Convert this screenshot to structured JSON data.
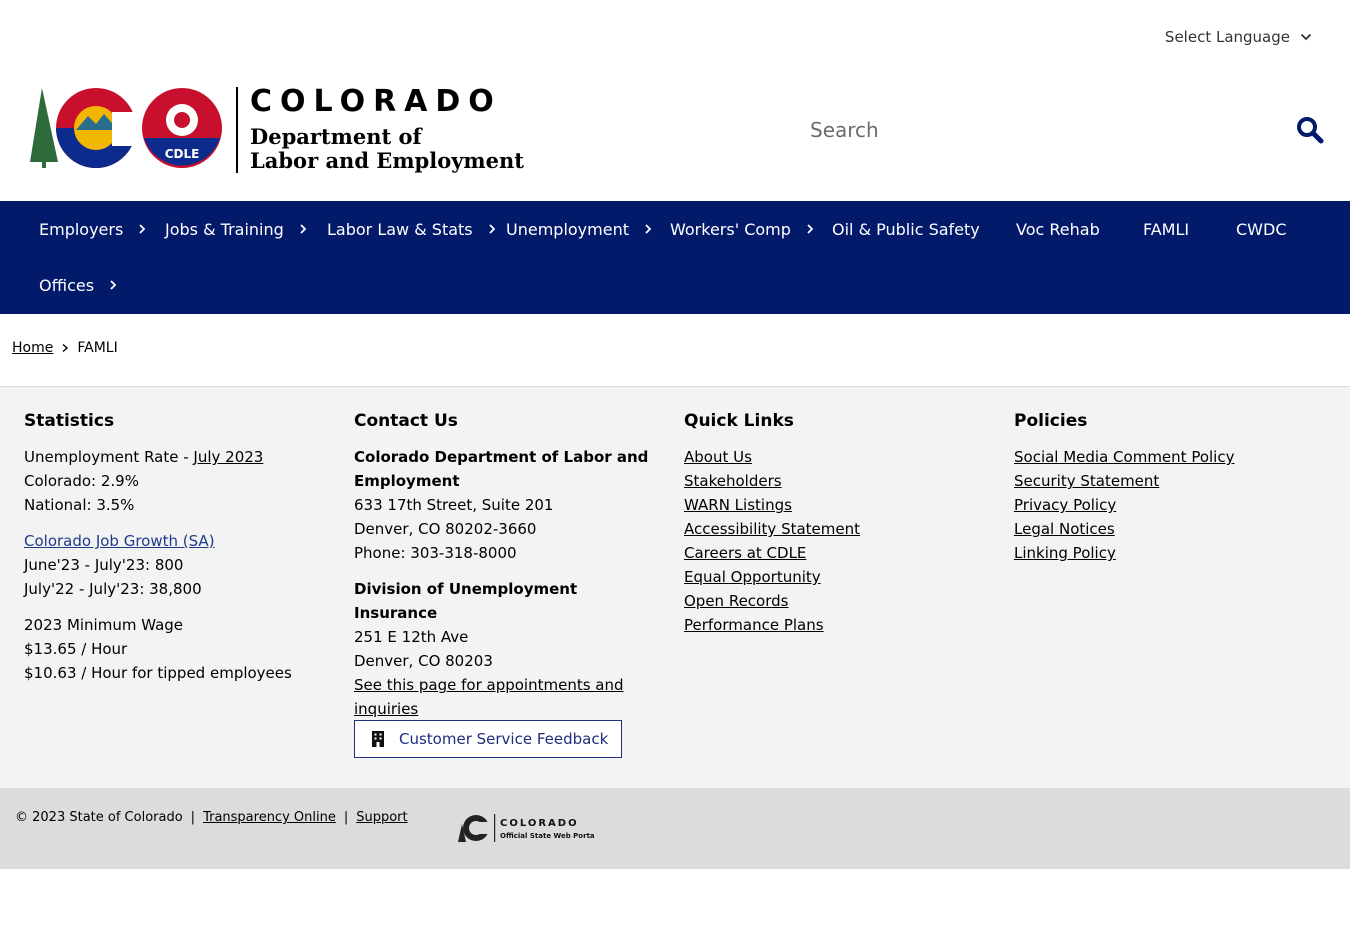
{
  "header": {
    "language_label": "Select Language",
    "brand": {
      "state_name": "COLORADO",
      "dept_line1": "Department of",
      "dept_line2": "Labor and Employment",
      "badge_text": "CDLE"
    },
    "search": {
      "placeholder": "Search"
    }
  },
  "nav": {
    "items": [
      {
        "label": "Employers",
        "has_submenu": true
      },
      {
        "label": "Jobs & Training",
        "has_submenu": true
      },
      {
        "label": "Labor Law & Stats",
        "has_submenu": true
      },
      {
        "label": "Unemployment",
        "has_submenu": true
      },
      {
        "label": "Workers' Comp",
        "has_submenu": true
      },
      {
        "label": "Oil & Public Safety",
        "has_submenu": false
      },
      {
        "label": "Voc Rehab",
        "has_submenu": false
      },
      {
        "label": "FAMLI",
        "has_submenu": false
      },
      {
        "label": "CWDC",
        "has_submenu": false
      },
      {
        "label": "Offices",
        "has_submenu": true
      }
    ]
  },
  "breadcrumb": {
    "home": "Home",
    "current": "FAMLI"
  },
  "footer": {
    "statistics": {
      "heading": "Statistics",
      "unemp_prefix": "Unemployment Rate - ",
      "unemp_link": "July 2023",
      "colorado": "Colorado: 2.9%",
      "national": "National: 3.5%",
      "job_growth_link": "Colorado Job Growth (SA)",
      "growth_1": "June'23 - July'23: 800",
      "growth_2": "July'22 - July'23: 38,800",
      "wage_heading": "2023 Minimum Wage",
      "wage_1": "$13.65 / Hour",
      "wage_2": "$10.63 / Hour for tipped employees"
    },
    "contact": {
      "heading": "Contact Us",
      "org_name": "Colorado Department of Labor and Employment",
      "address_1": "633 17th Street, Suite 201",
      "address_2": "Denver, CO  80202-3660",
      "phone": "Phone: 303-318-8000",
      "division": "Division of Unemployment Insurance",
      "div_address_1": "251 E 12th Ave",
      "div_address_2": "Denver, CO  80203",
      "appointments_link": "See this page for appointments and inquiries",
      "feedback_label": "Customer Service Feedback"
    },
    "quick_links": {
      "heading": "Quick Links",
      "items": [
        "About Us",
        "Stakeholders",
        "WARN Listings",
        "Accessibility Statement",
        "Careers at CDLE",
        "Equal Opportunity",
        "Open Records",
        "Performance Plans"
      ]
    },
    "policies": {
      "heading": "Policies",
      "items": [
        "Social Media Comment Policy",
        "Security Statement",
        "Privacy Policy",
        "Legal Notices",
        "Linking Policy"
      ]
    }
  },
  "legal": {
    "copyright": "© 2023 State of Colorado",
    "separator": "|",
    "transparency": "Transparency Online",
    "support": "Support",
    "portal_name": "COLORADO",
    "portal_sub": "Official State Web Portal"
  },
  "colors": {
    "nav_bg": "#031a6b",
    "brand_blue": "#0d2b8c",
    "brand_red": "#c8102e",
    "brand_gold": "#f2b705",
    "brand_green": "#2e6b3a",
    "link_blue": "#1f3a8a"
  },
  "icons": [
    "chevron-down-icon",
    "search-icon",
    "chevron-right-icon",
    "building-icon"
  ]
}
